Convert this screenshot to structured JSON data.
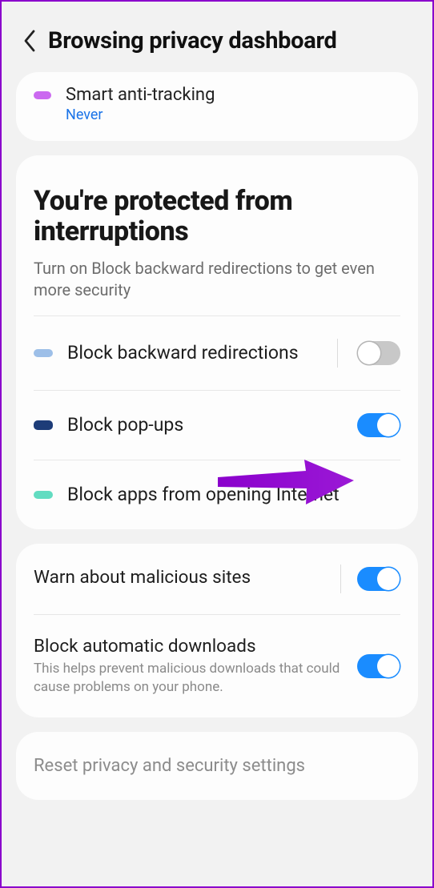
{
  "header": {
    "title": "Browsing privacy dashboard"
  },
  "top": {
    "smart_anti_tracking": {
      "label": "Smart anti-tracking",
      "value": "Never"
    }
  },
  "protected": {
    "title": "You're protected from interruptions",
    "subtitle": "Turn on Block backward redirections to get even more security",
    "rows": [
      {
        "label": "Block backward redirections",
        "toggle": "off"
      },
      {
        "label": "Block pop-ups",
        "toggle": "on"
      },
      {
        "label": "Block apps from opening Internet"
      }
    ]
  },
  "security": {
    "warn_malicious": {
      "label": "Warn about malicious sites",
      "toggle": "on"
    },
    "block_downloads": {
      "label": "Block automatic downloads",
      "desc": "This helps prevent malicious downloads that could cause problems on your phone.",
      "toggle": "on"
    }
  },
  "reset": {
    "label": "Reset privacy and security settings"
  },
  "colors": {
    "accent_arrow": "#8a00cc",
    "toggle_on": "#1a8cff",
    "link": "#1a73e8"
  }
}
